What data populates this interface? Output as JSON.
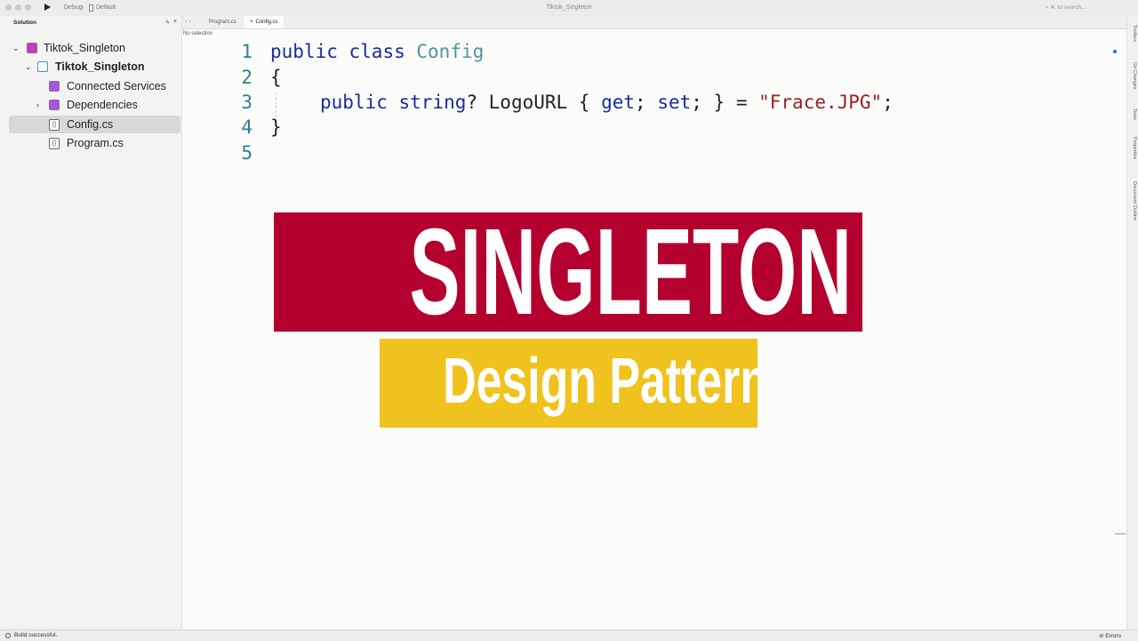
{
  "window": {
    "title": "Tiktok_Singleton",
    "config": "Debug",
    "device": "Default",
    "search_placeholder": "⌘. to search..."
  },
  "sidebar": {
    "header": "Solution",
    "tree": [
      {
        "label": "Tiktok_Singleton",
        "icon": "solution-icon"
      },
      {
        "label": "Tiktok_Singleton",
        "icon": "project-icon"
      },
      {
        "label": "Connected Services",
        "icon": "folder-icon"
      },
      {
        "label": "Dependencies",
        "icon": "folder-icon"
      },
      {
        "label": "Config.cs",
        "icon": "file-icon",
        "selected": true
      },
      {
        "label": "Program.cs",
        "icon": "file-icon"
      }
    ]
  },
  "tabs": [
    {
      "label": "Program.cs",
      "active": false
    },
    {
      "label": "Config.cs",
      "active": true
    }
  ],
  "breadcrumb": "No selection",
  "editor": {
    "line_numbers": [
      "1",
      "2",
      "3",
      "4",
      "5"
    ],
    "line1": {
      "kw1": "public",
      "kw2": "class",
      "type": "Config"
    },
    "line2": "{",
    "line3": {
      "kw1": "public",
      "kw2": "string",
      "mid": "? LogoURL { ",
      "get": "get",
      "semi1": "; ",
      "set": "set",
      "rest": "; } = ",
      "str": "\"Frace.JPG\"",
      "end": ";"
    },
    "line4": "}"
  },
  "banner": {
    "title": "SINGLETON",
    "subtitle": "Design Pattern",
    "title_bg": "#b3002e",
    "subtitle_bg": "#f0c21d"
  },
  "right_rail": [
    "Toolbox",
    "Git Changes",
    "Tests",
    "Properties",
    "Document Outline"
  ],
  "status": {
    "message": "Build successful.",
    "errors_label": "Errors"
  }
}
